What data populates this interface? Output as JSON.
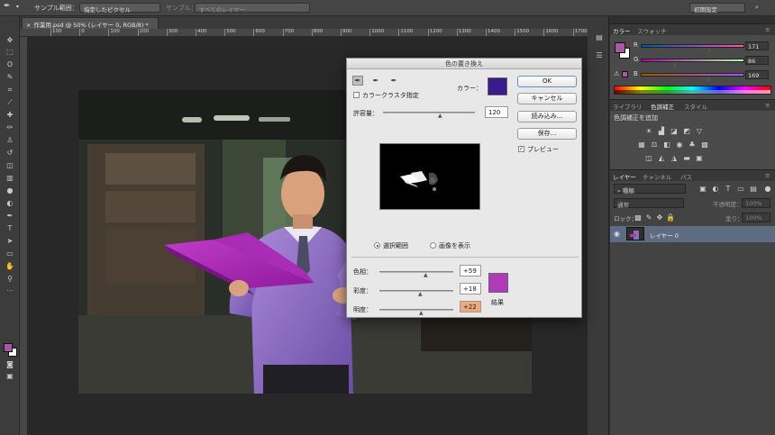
{
  "options_bar": {
    "sample_size_label": "サンプル範囲：",
    "sample_size_value": "指定したピクセル",
    "sample_label": "サンプル：",
    "sample_value": "すべてのレイヤー",
    "workspace_value": "初期設定"
  },
  "document": {
    "tab_label": "作業用.psd @ 50% (レイヤー 0, RGB/8) *",
    "ruler_ticks": [
      "100",
      "0",
      "100",
      "200",
      "300",
      "400",
      "500",
      "600",
      "700",
      "800",
      "900",
      "1000",
      "1100",
      "1200",
      "1300",
      "1400",
      "1500",
      "1600",
      "1700"
    ]
  },
  "color_panel": {
    "tabs": [
      "カラー",
      "スウォッチ"
    ],
    "r_label": "R",
    "r_value": "171",
    "g_label": "G",
    "g_value": "86",
    "b_label": "B",
    "b_value": "169",
    "r_level": 0.67,
    "g_level": 0.34,
    "b_level": 0.66,
    "foreground": "#ab56a9"
  },
  "adjust_panel": {
    "tabs": [
      "ライブラリ",
      "色調補正",
      "スタイル"
    ],
    "header": "色調補正を追加"
  },
  "layers_panel": {
    "tabs": [
      "レイヤー",
      "チャンネル",
      "パス"
    ],
    "filter_label": "種類",
    "blend_mode": "通常",
    "opacity_label": "不透明度：",
    "opacity_value": "100%",
    "lock_label": "ロック：",
    "fill_label": "塗り：",
    "fill_value": "100%",
    "layer_name": "レイヤー 0"
  },
  "dialog": {
    "title": "色の置き換え",
    "ok": "OK",
    "cancel": "キャンセル",
    "load": "読み込み...",
    "save": "保存...",
    "preview_label": "プレビュー",
    "localized_label": "カラークラスタ指定",
    "color_label": "カラー：",
    "color_swatch": "#3a1a8c",
    "fuzziness_label": "許容量：",
    "fuzziness_value": "120",
    "selection_label": "選択範囲",
    "image_label": "画像を表示",
    "hue_label": "色相：",
    "hue_value": "+59",
    "saturation_label": "彩度：",
    "saturation_value": "+18",
    "lightness_label": "明度：",
    "lightness_value": "+22",
    "result_label": "結果",
    "result_swatch": "#b03ab8"
  }
}
